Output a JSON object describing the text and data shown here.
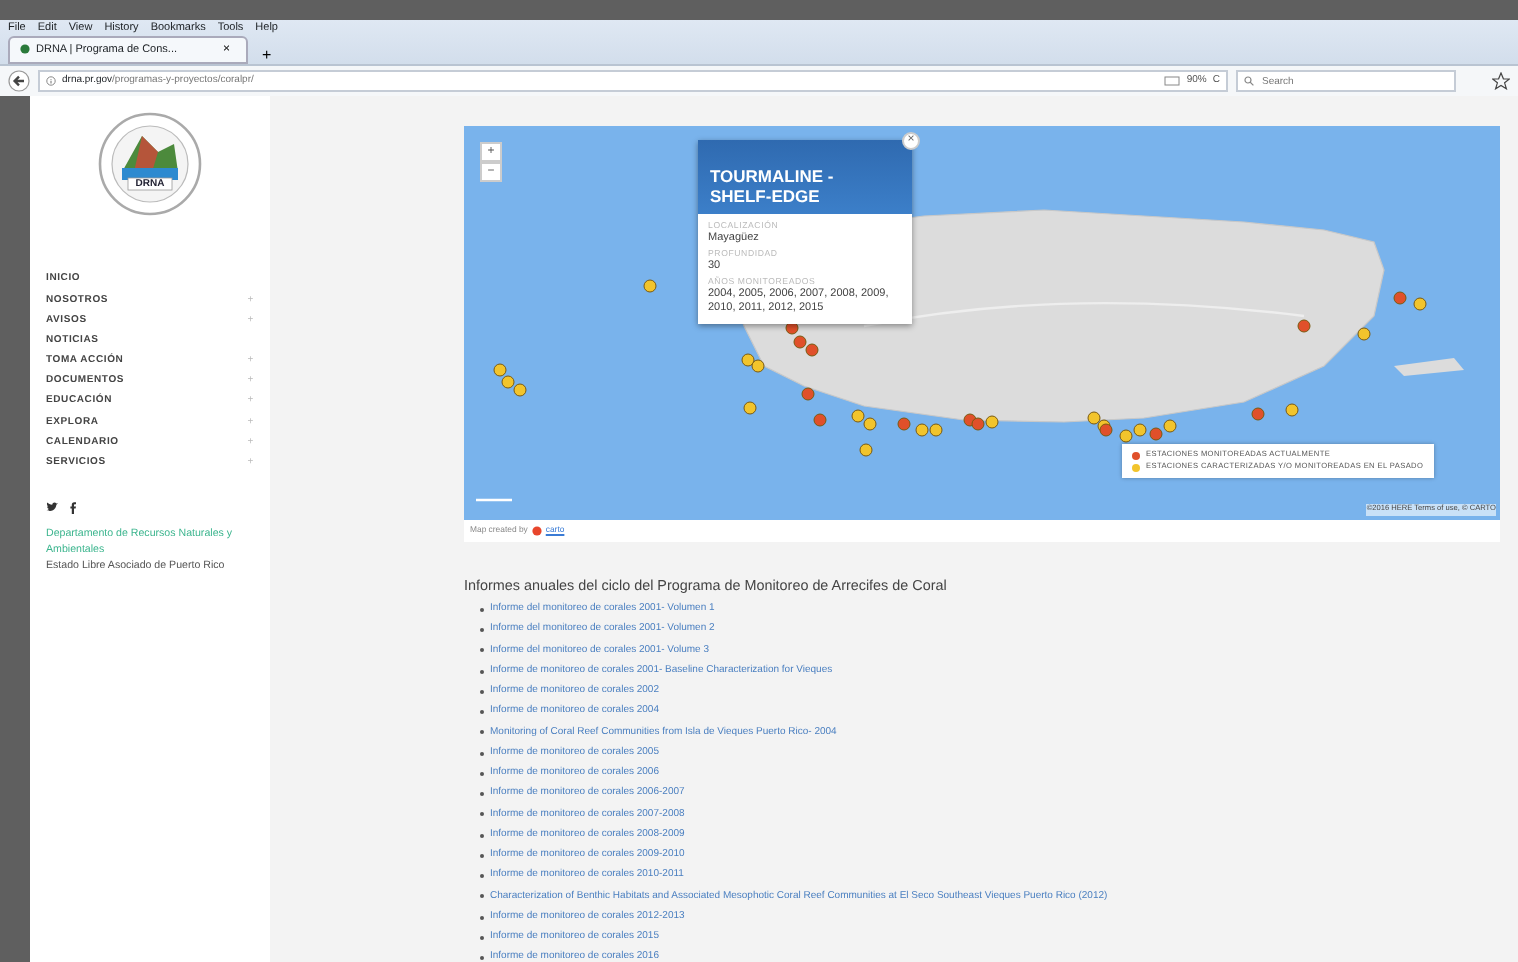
{
  "browser": {
    "menu": [
      "File",
      "Edit",
      "View",
      "History",
      "Bookmarks",
      "Tools",
      "Help"
    ],
    "tab": {
      "title": "DRNA | Programa de Cons...",
      "close": "×"
    },
    "new_tab": "+",
    "url_host": "drna.pr.gov",
    "url_path": "/programas-y-proyectos/coralpr/",
    "zoom": "90%",
    "reload": "C",
    "search": {
      "placeholder": "Search"
    }
  },
  "sidebar": {
    "logo_text": "DRNA",
    "nav": [
      {
        "label": "INICIO",
        "expandable": false
      },
      {
        "label": "NOSOTROS",
        "expandable": true
      },
      {
        "label": "AVISOS",
        "expandable": true
      },
      {
        "label": "NOTICIAS",
        "expandable": false
      },
      {
        "label": "TOMA ACCIÓN",
        "expandable": true
      },
      {
        "label": "DOCUMENTOS",
        "expandable": true
      },
      {
        "label": "EDUCACIÓN",
        "expandable": true
      },
      {
        "label": "EXPLORA",
        "expandable": true
      },
      {
        "label": "CALENDARIO",
        "expandable": true
      },
      {
        "label": "SERVICIOS",
        "expandable": true
      }
    ],
    "toggle": "+",
    "agency_link": "Departamento de Recursos Naturales y Ambientales",
    "government": "Estado Libre Asociado de Puerto Rico"
  },
  "map": {
    "zoom_in": "+",
    "zoom_out": "−",
    "popup": {
      "title": "TOURMALINE - SHELF-EDGE",
      "close": "×",
      "fields": [
        {
          "label": "LOCALIZACIÓN",
          "value": "Mayagüez"
        },
        {
          "label": "PROFUNDIDAD",
          "value": "30"
        },
        {
          "label": "AÑOS MONITOREADOS",
          "value": "2004, 2005, 2006, 2007, 2008, 2009, 2010, 2011, 2012, 2015"
        }
      ]
    },
    "legend": [
      {
        "label": "ESTACIONES MONITOREADAS ACTUALMENTE",
        "color": "#e0502a"
      },
      {
        "label": "ESTACIONES CARACTERIZADAS Y/O MONITOREADAS EN EL PASADO",
        "color": "#f2c42c"
      }
    ],
    "markers": [
      {
        "color": "#f2c42c"
      },
      {
        "color": "#f2c42c"
      },
      {
        "color": "#f2c42c"
      },
      {
        "color": "#f2c42c"
      },
      {
        "color": "#e0502a"
      },
      {
        "color": "#e0502a"
      },
      {
        "color": "#e0502a"
      },
      {
        "color": "#f2c42c"
      },
      {
        "color": "#f2c42c"
      },
      {
        "color": "#e0502a"
      },
      {
        "color": "#f2c42c"
      },
      {
        "color": "#e0502a"
      },
      {
        "color": "#f2c42c"
      },
      {
        "color": "#f2c42c"
      },
      {
        "color": "#e0502a"
      },
      {
        "color": "#f2c42c"
      },
      {
        "color": "#f2c42c"
      },
      {
        "color": "#f2c42c"
      },
      {
        "color": "#e0502a"
      },
      {
        "color": "#f2c42c"
      },
      {
        "color": "#e0502a"
      },
      {
        "color": "#f2c42c"
      },
      {
        "color": "#f2c42c"
      },
      {
        "color": "#e0502a"
      },
      {
        "color": "#f2c42c"
      },
      {
        "color": "#f2c42c"
      },
      {
        "color": "#e0502a"
      },
      {
        "color": "#f2c42c"
      },
      {
        "color": "#e0502a"
      },
      {
        "color": "#f2c42c"
      },
      {
        "color": "#e0502a"
      },
      {
        "color": "#f2c42c"
      },
      {
        "color": "#f2c42c"
      },
      {
        "color": "#e0502a"
      }
    ],
    "attribution": "©2016 HERE Terms of use, © CARTO",
    "credit_prefix": "Map created by",
    "credit_link": "carto"
  },
  "reports": {
    "title": "Informes anuales del ciclo del Programa de Monitoreo de Arrecifes de Coral",
    "items": [
      "Informe del monitoreo de corales 2001- Volumen 1",
      "Informe del monitoreo de corales 2001- Volumen 2",
      "Informe del monitoreo de corales 2001- Volume 3",
      "Informe de monitoreo de corales 2001- Baseline Characterization for Vieques",
      "Informe de monitoreo de corales 2002",
      "Informe de monitoreo de corales 2004",
      "Monitoring of Coral Reef Communities from Isla de Vieques Puerto Rico- 2004",
      "Informe de monitoreo de corales 2005",
      "Informe de monitoreo de corales 2006",
      "Informe de monitoreo de corales 2006-2007",
      "Informe de monitoreo de corales 2007-2008",
      "Informe de monitoreo de corales 2008-2009",
      "Informe de monitoreo de corales 2009-2010",
      "Informe de monitoreo de corales 2010-2011",
      "Characterization of Benthic Habitats and Associated Mesophotic Coral Reef Communities at El Seco Southeast Vieques Puerto Rico (2012)",
      "Informe de monitoreo de corales 2012-2013",
      "Informe de monitoreo de corales 2015",
      "Informe de monitoreo de corales 2016"
    ]
  }
}
